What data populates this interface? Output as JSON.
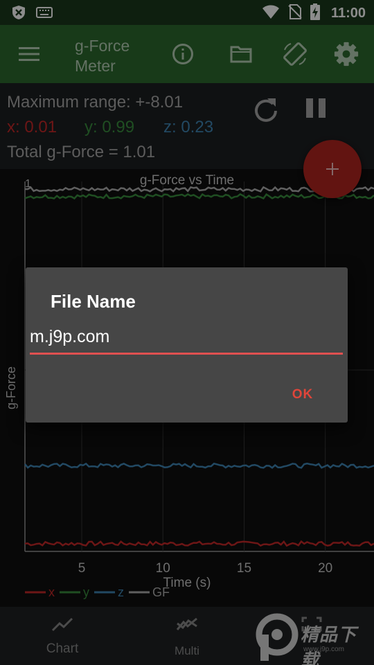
{
  "status_bar": {
    "time": "11:00",
    "icons": [
      "vpn-shield-icon",
      "keyboard-icon",
      "wifi-icon",
      "no-sim-icon",
      "battery-charging-icon"
    ]
  },
  "toolbar": {
    "title": "g-Force Meter",
    "icons": [
      "menu-icon",
      "info-icon",
      "folder-icon",
      "screen-rotation-icon",
      "settings-icon"
    ]
  },
  "readout": {
    "max_range": "Maximum range: +-8.01",
    "x": "x: 0.01",
    "y": "y: 0.99",
    "z": "z: 0.23",
    "total": "Total g-Force = 1.01",
    "colors": {
      "x": "#c62828",
      "y": "#3a8f3e",
      "z": "#3f86b5",
      "gf": "#b0b0b0"
    }
  },
  "fab": {
    "icon": "plus-icon",
    "label": "+"
  },
  "chart_data": {
    "type": "line",
    "title": "g-Force vs Time",
    "xlabel": "Time (s)",
    "ylabel": "g-Force",
    "x_ticks": [
      "5",
      "10",
      "15",
      "20"
    ],
    "y_ticks": [
      "1"
    ],
    "xlim": [
      1.5,
      23
    ],
    "grid": true,
    "legend": "bottom-left",
    "series": [
      {
        "name": "x",
        "value": 0.01
      },
      {
        "name": "y",
        "value": 0.99
      },
      {
        "name": "z",
        "value": 0.23
      },
      {
        "name": "GF",
        "value": 1.01
      }
    ]
  },
  "dialog": {
    "title": "File Name",
    "input_value": "m.j9p.com",
    "ok_label": "OK"
  },
  "bottom_nav": {
    "items": [
      {
        "label": "Chart",
        "icon": "chart-line-icon"
      },
      {
        "label": "Multi",
        "icon": "multi-chart-icon"
      },
      {
        "label": "",
        "icon": "fullscreen-icon"
      }
    ]
  },
  "watermark": {
    "text": "精品下载",
    "sub": "www.j9p.com"
  }
}
